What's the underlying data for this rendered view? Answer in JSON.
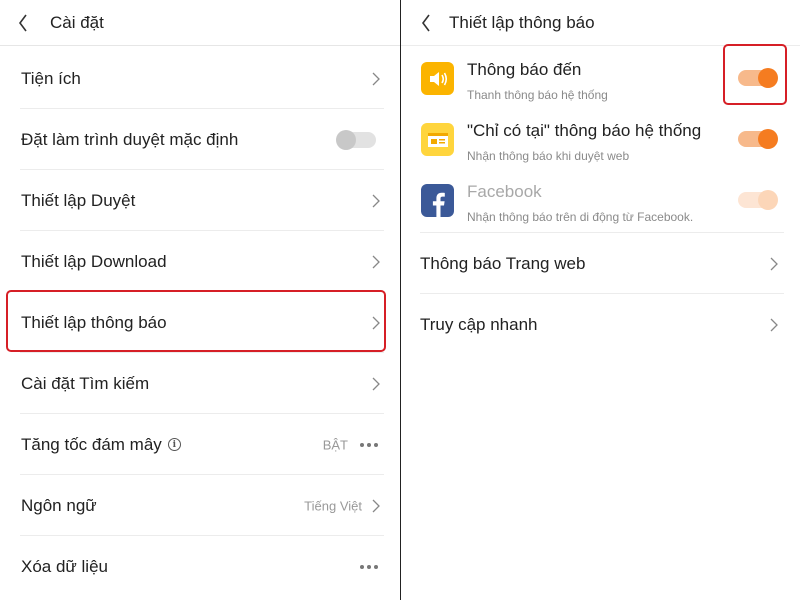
{
  "left": {
    "header": {
      "title": "Cài đặt"
    },
    "items": [
      {
        "label": "Tiện ích"
      },
      {
        "label": "Đặt làm trình duyệt mặc định"
      },
      {
        "label": "Thiết lập Duyệt"
      },
      {
        "label": "Thiết lập Download"
      },
      {
        "label": "Thiết lập thông báo"
      },
      {
        "label": "Cài đặt Tìm kiếm"
      },
      {
        "label": "Tăng tốc đám mây",
        "value": "BẬT"
      },
      {
        "label": "Ngôn ngữ",
        "value": "Tiếng Việt"
      },
      {
        "label": "Xóa dữ liệu"
      }
    ]
  },
  "right": {
    "header": {
      "title": "Thiết lập thông báo"
    },
    "notifications": [
      {
        "title": "Thông báo đến",
        "subtitle": "Thanh thông báo hệ thống",
        "icon": "speaker-icon",
        "enabled": true
      },
      {
        "title": "\"Chỉ có tại\" thông báo hệ thống",
        "subtitle": "Nhận thông báo khi duyệt web",
        "icon": "news-card-icon",
        "enabled": true
      },
      {
        "title": "Facebook",
        "subtitle": "Nhận thông báo trên di động từ Facebook.",
        "icon": "facebook-icon",
        "enabled": true,
        "disabled": true
      }
    ],
    "items": [
      {
        "label": "Thông báo Trang web"
      },
      {
        "label": "Truy cập nhanh"
      }
    ]
  },
  "colors": {
    "accent_orange": "#f57c20",
    "highlight_red": "#d61f26",
    "speaker_icon_bg": "#fbb400",
    "news_icon_bg": "#ffd53d",
    "facebook_blue": "#3b5998"
  }
}
